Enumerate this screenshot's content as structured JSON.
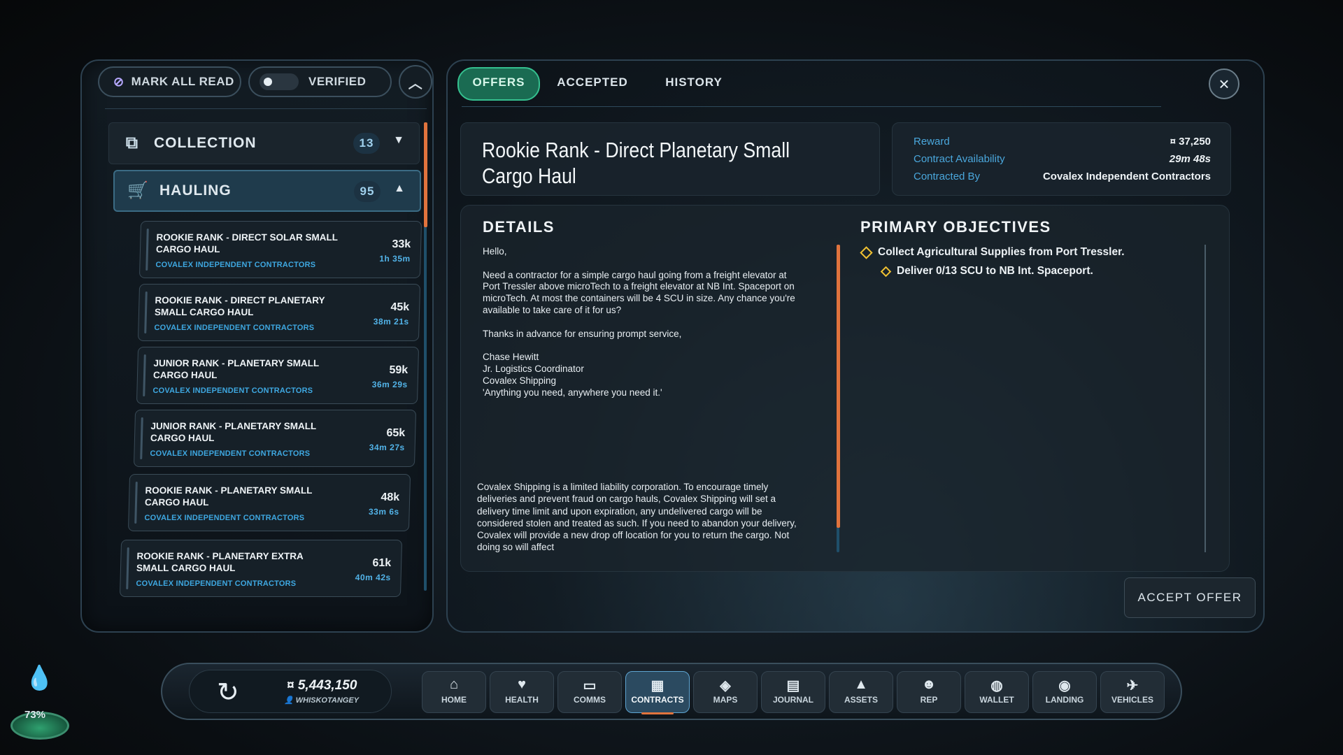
{
  "toolbar": {
    "mark_all_read": "MARK ALL READ",
    "verified": "VERIFIED"
  },
  "categories": [
    {
      "label": "COLLECTION",
      "count": "13"
    },
    {
      "label": "HAULING",
      "count": "95"
    }
  ],
  "offers": [
    {
      "title": "ROOKIE RANK - DIRECT SOLAR SMALL CARGO HAUL",
      "contractor": "COVALEX INDEPENDENT CONTRACTORS",
      "reward": "33k",
      "time": "1h 35m"
    },
    {
      "title": "ROOKIE RANK - DIRECT PLANETARY SMALL CARGO HAUL",
      "contractor": "COVALEX INDEPENDENT CONTRACTORS",
      "reward": "45k",
      "time": "38m 21s"
    },
    {
      "title": "JUNIOR RANK - PLANETARY SMALL CARGO HAUL",
      "contractor": "COVALEX INDEPENDENT CONTRACTORS",
      "reward": "59k",
      "time": "36m 29s"
    },
    {
      "title": "JUNIOR RANK - PLANETARY SMALL CARGO HAUL",
      "contractor": "COVALEX INDEPENDENT CONTRACTORS",
      "reward": "65k",
      "time": "34m 27s"
    },
    {
      "title": "ROOKIE RANK - PLANETARY SMALL CARGO HAUL",
      "contractor": "COVALEX INDEPENDENT CONTRACTORS",
      "reward": "48k",
      "time": "33m 6s"
    },
    {
      "title": "ROOKIE RANK - PLANETARY EXTRA SMALL CARGO HAUL",
      "contractor": "COVALEX INDEPENDENT CONTRACTORS",
      "reward": "61k",
      "time": "40m 42s"
    }
  ],
  "tabs": [
    "OFFERS",
    "ACCEPTED",
    "HISTORY"
  ],
  "contract": {
    "title": "Rookie Rank - Direct Planetary Small Cargo Haul",
    "reward_label": "Reward",
    "reward_value": "¤ 37,250",
    "availability_label": "Contract Availability",
    "availability_value": "29m 48s",
    "contracted_by_label": "Contracted By",
    "contracted_by_value": "Covalex Independent Contractors"
  },
  "details": {
    "heading": "DETAILS",
    "greeting": "Hello,",
    "body": "Need a contractor for a simple cargo haul going from a freight elevator at Port Tressler above microTech to a freight elevator at NB Int. Spaceport on microTech. At most the containers will be 4 SCU in size. Any chance you're available to take care of it for us?",
    "thanks": "Thanks in advance for ensuring prompt service,",
    "signature": [
      "Chase Hewitt",
      "Jr. Logistics Coordinator",
      "Covalex Shipping",
      "'Anything you need, anywhere you need it.'"
    ],
    "legal": "Covalex Shipping is a limited liability corporation. To encourage timely deliveries and prevent fraud on cargo hauls, Covalex Shipping will set a delivery time limit and upon expiration, any undelivered cargo will be considered stolen and treated as such. If you need to abandon your delivery, Covalex will provide a new drop off location for you to return the cargo. Not doing so will affect"
  },
  "objectives": {
    "heading": "PRIMARY OBJECTIVES",
    "items": [
      "Collect Agricultural Supplies from Port Tressler.",
      "Deliver 0/13 SCU to NB Int. Spaceport."
    ]
  },
  "accept_button": "ACCEPT OFFER",
  "user": {
    "balance": "5,443,150",
    "handle": "WHISKOTANGEY"
  },
  "nav": [
    {
      "label": "HOME",
      "icon": "home-icon"
    },
    {
      "label": "HEALTH",
      "icon": "heart-icon"
    },
    {
      "label": "COMMS",
      "icon": "chat-icon"
    },
    {
      "label": "CONTRACTS",
      "icon": "contracts-icon"
    },
    {
      "label": "MAPS",
      "icon": "map-icon"
    },
    {
      "label": "JOURNAL",
      "icon": "journal-icon"
    },
    {
      "label": "ASSETS",
      "icon": "assets-icon"
    },
    {
      "label": "REP",
      "icon": "rep-icon"
    },
    {
      "label": "WALLET",
      "icon": "wallet-icon"
    },
    {
      "label": "LANDING",
      "icon": "landing-icon"
    },
    {
      "label": "VEHICLES",
      "icon": "vehicles-icon"
    }
  ],
  "hud": {
    "percent": "73%"
  },
  "colors": {
    "accent_orange": "#e0733d",
    "accent_blue": "#3ea7e0",
    "offers_green": "#1a6b52",
    "objective_yellow": "#f1c232"
  }
}
